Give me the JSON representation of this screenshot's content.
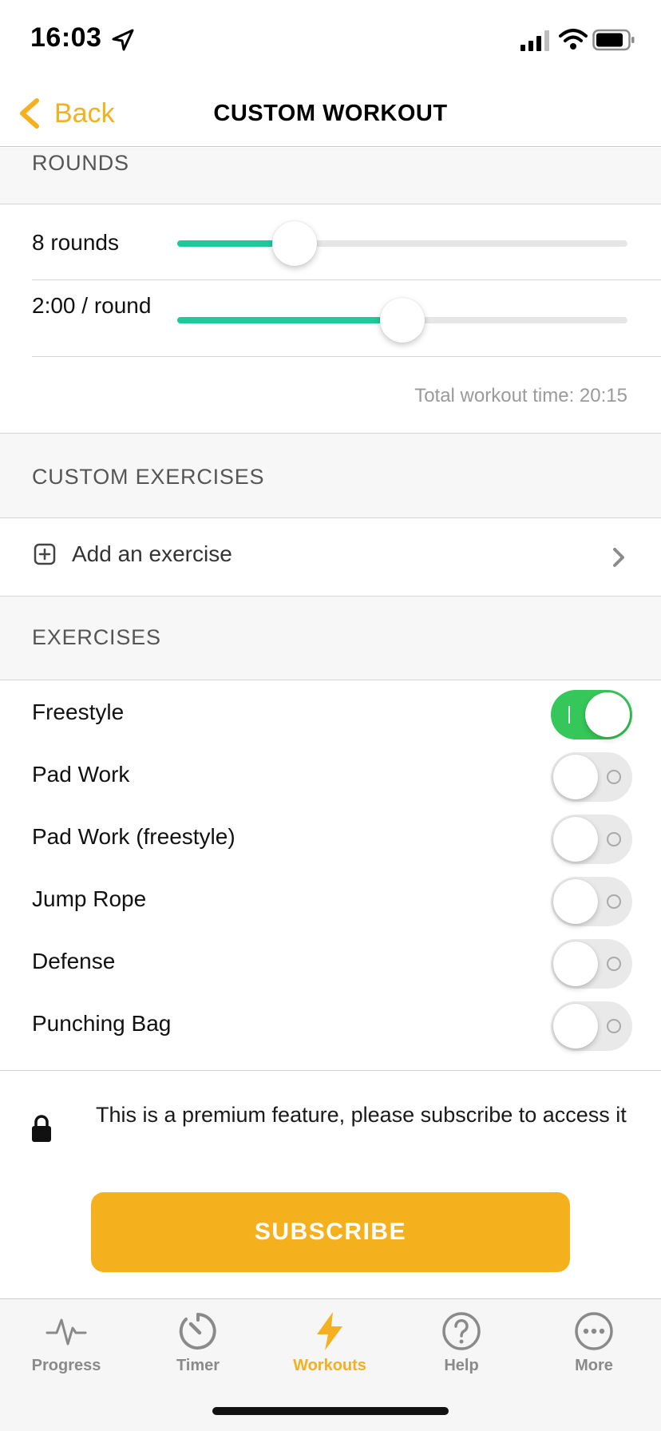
{
  "status_bar": {
    "time": "16:03"
  },
  "nav": {
    "back_label": "Back",
    "title": "CUSTOM WORKOUT"
  },
  "rounds_section": {
    "header": "ROUNDS",
    "rounds_label": "8 rounds",
    "rounds_slider_level": 0.26,
    "duration_label": "2:00 / round",
    "duration_slider_level": 0.5,
    "total_time": "Total workout time: 20:15"
  },
  "custom_exercises": {
    "header": "CUSTOM EXERCISES",
    "add_label": "Add an exercise"
  },
  "exercises": {
    "header": "EXERCISES",
    "items": [
      {
        "label": "Freestyle",
        "on": true
      },
      {
        "label": "Pad Work",
        "on": false
      },
      {
        "label": "Pad Work (freestyle)",
        "on": false
      },
      {
        "label": "Jump Rope",
        "on": false
      },
      {
        "label": "Defense",
        "on": false
      },
      {
        "label": "Punching Bag",
        "on": false
      }
    ]
  },
  "premium": {
    "message": "This is a premium feature, please subscribe to access it",
    "button_label": "SUBSCRIBE"
  },
  "tabs": [
    {
      "label": "Progress",
      "icon": "pulse-icon",
      "active": false
    },
    {
      "label": "Timer",
      "icon": "timer-icon",
      "active": false
    },
    {
      "label": "Workouts",
      "icon": "lightning-icon",
      "active": true
    },
    {
      "label": "Help",
      "icon": "help-icon",
      "active": false
    },
    {
      "label": "More",
      "icon": "more-icon",
      "active": false
    }
  ],
  "colors": {
    "accent": "#f4b01e",
    "slider_fill": "#1ec99a",
    "toggle_on": "#35c759",
    "subscribe": "#f5b11d"
  }
}
